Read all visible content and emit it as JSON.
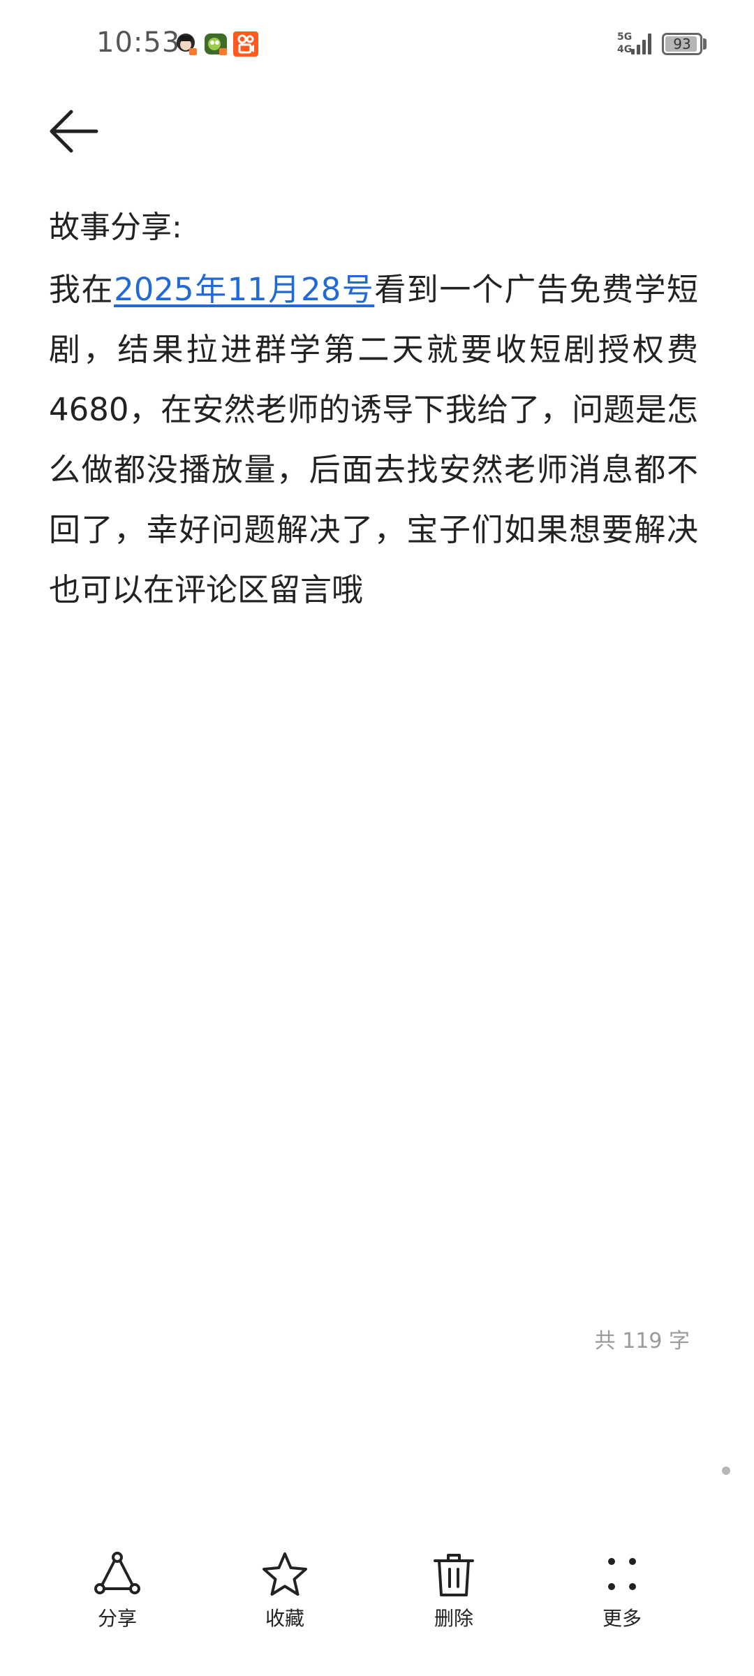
{
  "status_bar": {
    "time": "10:53",
    "network_top": "5G",
    "network_bottom": "4G",
    "battery": "93",
    "battery_level": 0.93
  },
  "note": {
    "title": "故事分享:",
    "body_prefix": "我在",
    "date_link": "2025年11月28号",
    "body_rest": "看到一个广告免费学短剧，结果拉进群学第二天就要收短剧授权费4680，在安然老师的诱导下我给了，问题是怎么做都没播放量，后面去找安然老师消息都不回了，幸好问题解决了，宝子们如果想要解决也可以在评论区留言哦",
    "word_count": "共 119 字"
  },
  "toolbar": {
    "share": {
      "label": "分享",
      "icon": "share-icon"
    },
    "favorite": {
      "label": "收藏",
      "icon": "star-icon"
    },
    "delete": {
      "label": "删除",
      "icon": "trash-icon"
    },
    "more": {
      "label": "更多",
      "icon": "more-dots-icon"
    }
  },
  "colors": {
    "link": "#1f6ad6",
    "text": "#222222",
    "muted": "#9a9a9a",
    "notif_orange": "#ff5a1f"
  }
}
